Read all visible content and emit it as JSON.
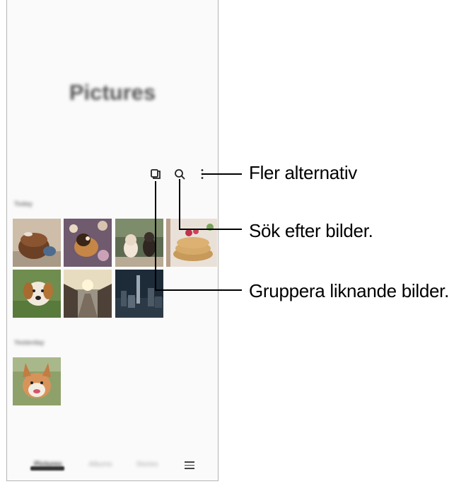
{
  "app": {
    "title": "Pictures",
    "section_recent": "Today",
    "section_older": "Yesterday"
  },
  "toolbar": {
    "icons": [
      "group-similar-icon",
      "search-icon",
      "more-options-icon"
    ]
  },
  "bottom_nav": {
    "tabs": [
      {
        "label": "Pictures",
        "selected": true
      },
      {
        "label": "Albums",
        "selected": false
      },
      {
        "label": "Stories",
        "selected": false
      }
    ],
    "menu_icon": "menu-icon"
  },
  "callouts": {
    "more_options": "Fler alternativ",
    "search": "Sök efter bilder.",
    "group_similar": "Gruppera liknande bilder."
  },
  "colors": {
    "callout_line": "#000000",
    "phone_border": "#b5b5b5"
  }
}
